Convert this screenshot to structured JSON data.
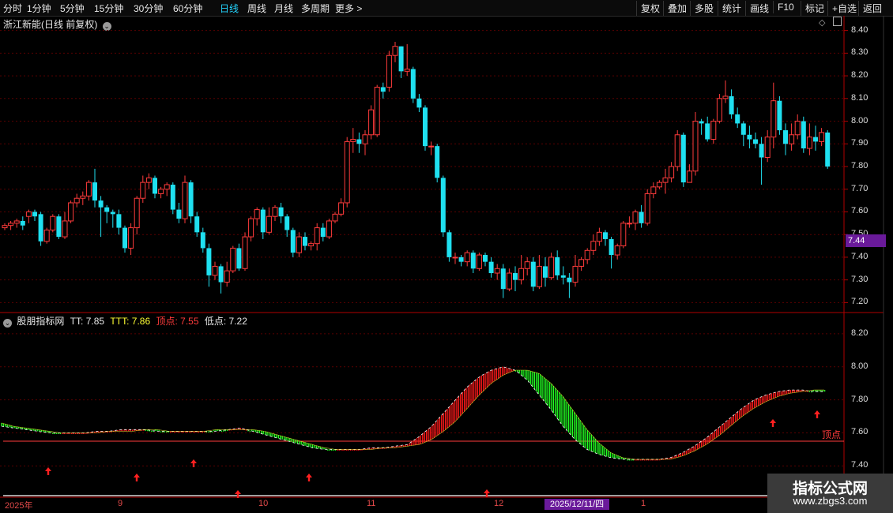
{
  "toolbar": {
    "periods": [
      "分时",
      "1分钟",
      "5分钟",
      "15分钟",
      "30分钟",
      "60分钟",
      "日线",
      "周线",
      "月线",
      "多周期",
      "更多 >"
    ],
    "active_period": "日线",
    "actions": [
      "复权",
      "叠加",
      "多股",
      "统计",
      "画线",
      "F10",
      "标记",
      "+自选",
      "返回"
    ]
  },
  "main_chart": {
    "title": "浙江新能(日线 前复权)",
    "y_ticks": [
      "8.40",
      "8.30",
      "8.20",
      "8.10",
      "8.00",
      "7.90",
      "7.80",
      "7.70",
      "7.60",
      "7.50",
      "7.40",
      "7.30",
      "7.20"
    ],
    "current_price": "7.44"
  },
  "indicator": {
    "name": "股朋指标网",
    "tt_label": "TT:",
    "tt_value": "7.85",
    "ttt_label": "TTT:",
    "ttt_value": "7.86",
    "top_label": "顶点:",
    "top_value": "7.55",
    "low_label": "低点:",
    "low_value": "7.22",
    "line_label": "顶点",
    "y_ticks": [
      "8.20",
      "8.00",
      "7.80",
      "7.60",
      "7.40"
    ]
  },
  "x_axis": {
    "labels": [
      "2025年",
      "9",
      "10",
      "11",
      "12",
      "1"
    ],
    "crosshair_date": "2025/12/11/四"
  },
  "watermark": {
    "title": "指标公式网",
    "url": "www.zbgs3.com"
  },
  "colors": {
    "up": "#ff3b3b",
    "down": "#1fe0f0",
    "ribbon_up": "#ff1a1a",
    "ribbon_down": "#22ff22",
    "accent": "#23d5ff"
  },
  "chart_data": {
    "type": "candlestick",
    "title": "浙江新能(日线 前复权)",
    "ylim": [
      7.17,
      8.43
    ],
    "x_labels": [
      "2025年",
      "9",
      "10",
      "11",
      "12",
      "1"
    ],
    "candles": [
      [
        7.53,
        7.54,
        7.52,
        7.55
      ],
      [
        7.54,
        7.55,
        7.52,
        7.56
      ],
      [
        7.55,
        7.56,
        7.53,
        7.57
      ],
      [
        7.56,
        7.54,
        7.52,
        7.58
      ],
      [
        7.58,
        7.6,
        7.55,
        7.61
      ],
      [
        7.6,
        7.58,
        7.56,
        7.61
      ],
      [
        7.59,
        7.47,
        7.45,
        7.6
      ],
      [
        7.47,
        7.52,
        7.46,
        7.53
      ],
      [
        7.52,
        7.58,
        7.51,
        7.59
      ],
      [
        7.58,
        7.49,
        7.48,
        7.59
      ],
      [
        7.49,
        7.56,
        7.48,
        7.6
      ],
      [
        7.56,
        7.64,
        7.55,
        7.65
      ],
      [
        7.64,
        7.66,
        7.62,
        7.68
      ],
      [
        7.66,
        7.67,
        7.63,
        7.69
      ],
      [
        7.67,
        7.73,
        7.65,
        7.74
      ],
      [
        7.73,
        7.65,
        7.62,
        7.79
      ],
      [
        7.65,
        7.62,
        7.49,
        7.67
      ],
      [
        7.62,
        7.6,
        7.55,
        7.63
      ],
      [
        7.6,
        7.59,
        7.53,
        7.61
      ],
      [
        7.59,
        7.53,
        7.5,
        7.61
      ],
      [
        7.53,
        7.44,
        7.42,
        7.54
      ],
      [
        7.44,
        7.53,
        7.41,
        7.55
      ],
      [
        7.53,
        7.66,
        7.5,
        7.67
      ],
      [
        7.66,
        7.73,
        7.64,
        7.76
      ],
      [
        7.73,
        7.75,
        7.7,
        7.77
      ],
      [
        7.75,
        7.68,
        7.66,
        7.76
      ],
      [
        7.68,
        7.7,
        7.66,
        7.71
      ],
      [
        7.7,
        7.72,
        7.67,
        7.73
      ],
      [
        7.72,
        7.61,
        7.59,
        7.73
      ],
      [
        7.61,
        7.57,
        7.55,
        7.64
      ],
      [
        7.57,
        7.73,
        7.55,
        7.76
      ],
      [
        7.73,
        7.58,
        7.55,
        7.74
      ],
      [
        7.58,
        7.51,
        7.49,
        7.6
      ],
      [
        7.51,
        7.44,
        7.42,
        7.53
      ],
      [
        7.44,
        7.32,
        7.27,
        7.46
      ],
      [
        7.32,
        7.36,
        7.3,
        7.38
      ],
      [
        7.36,
        7.29,
        7.24,
        7.37
      ],
      [
        7.29,
        7.34,
        7.27,
        7.38
      ],
      [
        7.34,
        7.44,
        7.33,
        7.45
      ],
      [
        7.44,
        7.35,
        7.34,
        7.46
      ],
      [
        7.35,
        7.49,
        7.34,
        7.51
      ],
      [
        7.49,
        7.57,
        7.47,
        7.58
      ],
      [
        7.57,
        7.61,
        7.54,
        7.62
      ],
      [
        7.61,
        7.51,
        7.48,
        7.62
      ],
      [
        7.51,
        7.58,
        7.5,
        7.62
      ],
      [
        7.58,
        7.62,
        7.56,
        7.63
      ],
      [
        7.62,
        7.58,
        7.55,
        7.64
      ],
      [
        7.58,
        7.52,
        7.49,
        7.59
      ],
      [
        7.52,
        7.42,
        7.4,
        7.53
      ],
      [
        7.42,
        7.49,
        7.4,
        7.51
      ],
      [
        7.49,
        7.45,
        7.43,
        7.51
      ],
      [
        7.45,
        7.46,
        7.43,
        7.47
      ],
      [
        7.46,
        7.53,
        7.43,
        7.55
      ],
      [
        7.53,
        7.49,
        7.47,
        7.55
      ],
      [
        7.49,
        7.56,
        7.48,
        7.57
      ],
      [
        7.56,
        7.59,
        7.55,
        7.6
      ],
      [
        7.59,
        7.64,
        7.58,
        7.66
      ],
      [
        7.64,
        7.91,
        7.62,
        7.93
      ],
      [
        7.91,
        7.92,
        7.86,
        7.97
      ],
      [
        7.92,
        7.9,
        7.86,
        7.95
      ],
      [
        7.9,
        7.94,
        7.85,
        7.96
      ],
      [
        7.94,
        8.05,
        7.92,
        8.07
      ],
      [
        7.94,
        8.15,
        7.93,
        8.16
      ],
      [
        8.15,
        8.13,
        8.1,
        8.17
      ],
      [
        8.15,
        8.29,
        8.13,
        8.31
      ],
      [
        8.29,
        8.33,
        8.26,
        8.35
      ],
      [
        8.33,
        8.22,
        8.19,
        8.33
      ],
      [
        8.22,
        8.23,
        8.2,
        8.34
      ],
      [
        8.23,
        8.1,
        8.08,
        8.24
      ],
      [
        8.1,
        8.06,
        8.04,
        8.12
      ],
      [
        8.06,
        7.89,
        7.87,
        8.07
      ],
      [
        7.89,
        7.89,
        7.85,
        7.91
      ],
      [
        7.89,
        7.75,
        7.73,
        7.9
      ],
      [
        7.75,
        7.51,
        7.49,
        7.76
      ],
      [
        7.51,
        7.4,
        7.38,
        7.52
      ],
      [
        7.4,
        7.4,
        7.37,
        7.42
      ],
      [
        7.4,
        7.38,
        7.36,
        7.41
      ],
      [
        7.38,
        7.42,
        7.36,
        7.43
      ],
      [
        7.42,
        7.35,
        7.33,
        7.43
      ],
      [
        7.35,
        7.41,
        7.34,
        7.42
      ],
      [
        7.41,
        7.38,
        7.36,
        7.42
      ],
      [
        7.38,
        7.33,
        7.31,
        7.4
      ],
      [
        7.33,
        7.35,
        7.3,
        7.37
      ],
      [
        7.35,
        7.26,
        7.22,
        7.37
      ],
      [
        7.26,
        7.33,
        7.25,
        7.35
      ],
      [
        7.33,
        7.3,
        7.25,
        7.36
      ],
      [
        7.3,
        7.35,
        7.28,
        7.41
      ],
      [
        7.35,
        7.38,
        7.32,
        7.4
      ],
      [
        7.38,
        7.27,
        7.25,
        7.4
      ],
      [
        7.27,
        7.36,
        7.26,
        7.41
      ],
      [
        7.36,
        7.31,
        7.27,
        7.4
      ],
      [
        7.31,
        7.4,
        7.3,
        7.42
      ],
      [
        7.4,
        7.32,
        7.3,
        7.43
      ],
      [
        7.32,
        7.31,
        7.28,
        7.36
      ],
      [
        7.31,
        7.29,
        7.22,
        7.33
      ],
      [
        7.29,
        7.36,
        7.27,
        7.41
      ],
      [
        7.36,
        7.39,
        7.34,
        7.4
      ],
      [
        7.39,
        7.43,
        7.37,
        7.44
      ],
      [
        7.43,
        7.47,
        7.41,
        7.5
      ],
      [
        7.47,
        7.51,
        7.45,
        7.53
      ],
      [
        7.51,
        7.48,
        7.45,
        7.52
      ],
      [
        7.48,
        7.41,
        7.35,
        7.49
      ],
      [
        7.41,
        7.45,
        7.39,
        7.46
      ],
      [
        7.45,
        7.55,
        7.44,
        7.56
      ],
      [
        7.55,
        7.55,
        7.53,
        7.58
      ],
      [
        7.55,
        7.6,
        7.52,
        7.61
      ],
      [
        7.6,
        7.55,
        7.53,
        7.63
      ],
      [
        7.55,
        7.68,
        7.54,
        7.7
      ],
      [
        7.68,
        7.71,
        7.66,
        7.73
      ],
      [
        7.71,
        7.73,
        7.7,
        7.74
      ],
      [
        7.73,
        7.75,
        7.68,
        7.79
      ],
      [
        7.75,
        7.8,
        7.73,
        7.82
      ],
      [
        7.8,
        7.94,
        7.78,
        7.96
      ],
      [
        7.94,
        7.73,
        7.71,
        7.95
      ],
      [
        7.73,
        7.78,
        7.76,
        7.81
      ],
      [
        7.78,
        8.0,
        7.76,
        8.04
      ],
      [
        8.0,
        7.99,
        7.94,
        8.01
      ],
      [
        7.99,
        7.92,
        7.91,
        8.02
      ],
      [
        7.92,
        8.0,
        7.9,
        8.01
      ],
      [
        8.0,
        8.1,
        7.99,
        8.12
      ],
      [
        8.1,
        8.11,
        8.08,
        8.18
      ],
      [
        8.11,
        8.03,
        8.01,
        8.14
      ],
      [
        8.03,
        7.99,
        7.97,
        8.06
      ],
      [
        7.99,
        7.94,
        7.89,
        8.0
      ],
      [
        7.94,
        7.92,
        7.88,
        7.98
      ],
      [
        7.92,
        7.9,
        7.88,
        7.95
      ],
      [
        7.9,
        7.84,
        7.72,
        7.93
      ],
      [
        7.84,
        7.93,
        7.82,
        7.96
      ],
      [
        7.93,
        8.09,
        7.88,
        8.17
      ],
      [
        8.09,
        7.96,
        7.94,
        8.11
      ],
      [
        7.96,
        7.9,
        7.85,
        7.99
      ],
      [
        7.9,
        7.94,
        7.87,
        7.99
      ],
      [
        7.94,
        8.0,
        7.92,
        8.03
      ],
      [
        8.0,
        7.88,
        7.86,
        8.02
      ],
      [
        7.88,
        7.93,
        7.85,
        7.99
      ],
      [
        7.93,
        7.91,
        7.87,
        7.98
      ],
      [
        7.91,
        7.95,
        7.89,
        7.97
      ],
      [
        7.95,
        7.8,
        7.79,
        7.96
      ]
    ],
    "indicator_series": {
      "name": "股朋指标网",
      "ylim": [
        7.22,
        8.3
      ],
      "TT": [
        7.64,
        7.63,
        7.62,
        7.61,
        7.6,
        7.6,
        7.6,
        7.6,
        7.61,
        7.61,
        7.62,
        7.62,
        7.62,
        7.61,
        7.61,
        7.61,
        7.61,
        7.61,
        7.61,
        7.62,
        7.63,
        7.61,
        7.59,
        7.57,
        7.55,
        7.53,
        7.51,
        7.5,
        7.5,
        7.5,
        7.5,
        7.51,
        7.51,
        7.52,
        7.53,
        7.58,
        7.64,
        7.72,
        7.8,
        7.88,
        7.94,
        7.98,
        8.0,
        7.98,
        7.92,
        7.83,
        7.74,
        7.64,
        7.56,
        7.5,
        7.47,
        7.45,
        7.44,
        7.44,
        7.44,
        7.44,
        7.45,
        7.48,
        7.52,
        7.57,
        7.63,
        7.69,
        7.75,
        7.8,
        7.83,
        7.85,
        7.86,
        7.86,
        7.85,
        7.85
      ],
      "TTT": [
        7.66,
        7.64,
        7.63,
        7.62,
        7.61,
        7.6,
        7.6,
        7.6,
        7.6,
        7.61,
        7.61,
        7.61,
        7.62,
        7.62,
        7.61,
        7.61,
        7.61,
        7.61,
        7.62,
        7.62,
        7.62,
        7.62,
        7.61,
        7.59,
        7.57,
        7.55,
        7.53,
        7.51,
        7.5,
        7.5,
        7.5,
        7.5,
        7.51,
        7.51,
        7.52,
        7.53,
        7.56,
        7.61,
        7.67,
        7.75,
        7.83,
        7.9,
        7.95,
        7.98,
        7.98,
        7.96,
        7.9,
        7.82,
        7.72,
        7.62,
        7.54,
        7.48,
        7.45,
        7.44,
        7.44,
        7.44,
        7.44,
        7.46,
        7.49,
        7.53,
        7.58,
        7.64,
        7.7,
        7.75,
        7.79,
        7.82,
        7.84,
        7.85,
        7.86,
        7.86
      ],
      "top_line": 7.55,
      "low_line": 7.22
    }
  }
}
